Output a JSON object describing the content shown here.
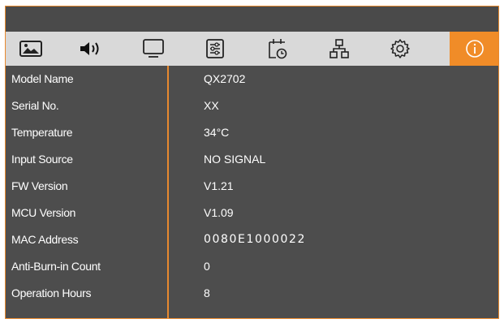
{
  "colors": {
    "accent": "#f08c28",
    "panel": "#4a4a4a",
    "tabbar": "#d9d9d9",
    "text": "#ffffff"
  },
  "tabs": [
    {
      "icon": "picture-icon",
      "active": false
    },
    {
      "icon": "speaker-icon",
      "active": false
    },
    {
      "icon": "monitor-icon",
      "active": false
    },
    {
      "icon": "sliders-icon",
      "active": false
    },
    {
      "icon": "calendar-timer-icon",
      "active": false
    },
    {
      "icon": "network-icon",
      "active": false
    },
    {
      "icon": "gear-icon",
      "active": false
    },
    {
      "icon": "info-icon",
      "active": true
    }
  ],
  "info": {
    "rows": [
      {
        "label": "Model Name",
        "value": "QX2702"
      },
      {
        "label": "Serial No.",
        "value": "XX"
      },
      {
        "label": "Temperature",
        "value": "34°C"
      },
      {
        "label": "Input Source",
        "value": "NO SIGNAL"
      },
      {
        "label": "FW Version",
        "value": "V1.21"
      },
      {
        "label": "MCU Version",
        "value": "V1.09"
      },
      {
        "label": "MAC Address",
        "value": "0080E1000022"
      },
      {
        "label": "Anti-Burn-in Count",
        "value": "0"
      },
      {
        "label": "Operation Hours",
        "value": "8"
      }
    ]
  }
}
